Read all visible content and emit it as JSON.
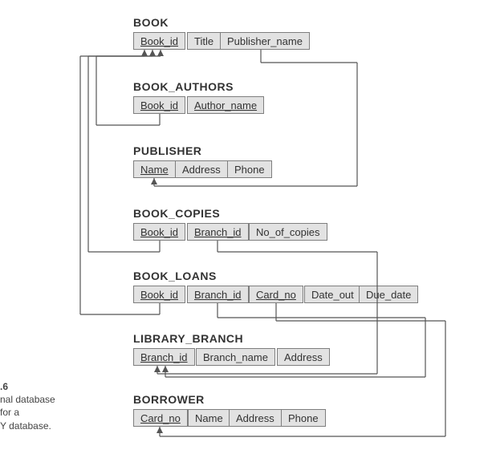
{
  "tables": {
    "book": {
      "title": "BOOK",
      "attrs": {
        "id": "Book_id",
        "title": "Title",
        "pub": "Publisher_name"
      }
    },
    "authors": {
      "title": "BOOK_AUTHORS",
      "attrs": {
        "id": "Book_id",
        "name": "Author_name"
      }
    },
    "publisher": {
      "title": "PUBLISHER",
      "attrs": {
        "name": "Name",
        "addr": "Address",
        "phone": "Phone"
      }
    },
    "copies": {
      "title": "BOOK_COPIES",
      "attrs": {
        "id": "Book_id",
        "branch": "Branch_id",
        "n": "No_of_copies"
      }
    },
    "loans": {
      "title": "BOOK_LOANS",
      "attrs": {
        "id": "Book_id",
        "branch": "Branch_id",
        "card": "Card_no",
        "dout": "Date_out",
        "due": "Due_date"
      }
    },
    "branch": {
      "title": "LIBRARY_BRANCH",
      "attrs": {
        "id": "Branch_id",
        "name": "Branch_name",
        "addr": "Address"
      }
    },
    "borrower": {
      "title": "BORROWER",
      "attrs": {
        "card": "Card_no",
        "name": "Name",
        "addr": "Address",
        "phone": "Phone"
      }
    }
  },
  "caption": {
    "num": ".6",
    "l1": "nal database",
    "l2": "for a",
    "l3": "Y database."
  }
}
